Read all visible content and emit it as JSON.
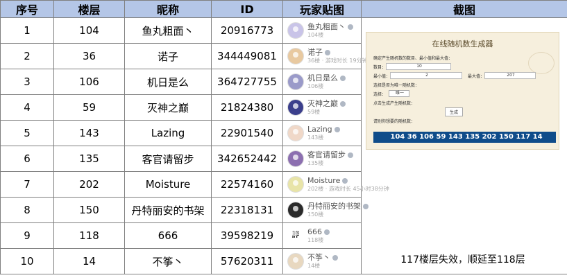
{
  "headers": {
    "index": "序号",
    "floor": "楼层",
    "nickname": "昵称",
    "id": "ID",
    "post": "玩家贴图",
    "screenshot": "截图"
  },
  "rows": [
    {
      "index": "1",
      "floor": "104",
      "nickname": "鱼丸粗面丶",
      "id": "20916773",
      "card_name": "鱼丸粗面丶",
      "card_sub": "104楼",
      "avatar_color": "#c9c4e8"
    },
    {
      "index": "2",
      "floor": "36",
      "nickname": "诺子",
      "id": "344449081",
      "card_name": "诺子",
      "card_sub": "36楼 · 游戏时长 19分钟",
      "avatar_color": "#e8c9a0"
    },
    {
      "index": "3",
      "floor": "106",
      "nickname": "机日是么",
      "id": "364727755",
      "card_name": "机日是么",
      "card_sub": "106楼",
      "avatar_color": "#9a9ac9"
    },
    {
      "index": "4",
      "floor": "59",
      "nickname": "灭神之巅",
      "id": "21824380",
      "card_name": "灭神之巅",
      "card_sub": "59楼",
      "avatar_color": "#3b3f8c"
    },
    {
      "index": "5",
      "floor": "143",
      "nickname": "Lazing",
      "id": "22901540",
      "card_name": "Lazing",
      "card_sub": "143楼",
      "avatar_color": "#f0d8c8"
    },
    {
      "index": "6",
      "floor": "135",
      "nickname": "客官请留步",
      "id": "342652442",
      "card_name": "客官请留步",
      "card_sub": "135楼",
      "avatar_color": "#8c6fb0"
    },
    {
      "index": "7",
      "floor": "202",
      "nickname": "Moisture",
      "id": "22574160",
      "card_name": "Moisture",
      "card_sub": "202楼 · 游戏时长 45小时38分钟",
      "avatar_color": "#e8e4a8"
    },
    {
      "index": "8",
      "floor": "150",
      "nickname": "丹特丽安的书架",
      "id": "22318131",
      "card_name": "丹特丽安的书架",
      "card_sub": "150楼",
      "avatar_color": "#2a2a2a"
    },
    {
      "index": "9",
      "floor": "118",
      "nickname": "666",
      "id": "39598219",
      "card_name": "666",
      "card_sub": "118楼",
      "avatar_color": "#ffffff",
      "avatar_text": "胖"
    },
    {
      "index": "10",
      "floor": "14",
      "nickname": "不筝丶",
      "id": "57620311",
      "card_name": "不筝丶",
      "card_sub": "14楼",
      "avatar_color": "#e8d8c0"
    }
  ],
  "generator": {
    "title": "在线随机数生成器",
    "intro": "确定产生随机数的数目、最小值和最大值：",
    "count_label": "数目：",
    "count_value": "10",
    "min_label": "最小值：",
    "min_value": "2",
    "max_label": "最大值：",
    "max_value": "207",
    "unique_prompt": "选择是否为唯一随机数：",
    "unique_label": "选择：",
    "unique_value": "唯一",
    "generate_prompt": "点击生成产生随机数：",
    "generate_button": "生成",
    "result_label": "请别你想要的随机数：",
    "result": "104  36  106  59  143  135  202  150  117  14"
  },
  "note": "117楼层失效，顺延至118层"
}
